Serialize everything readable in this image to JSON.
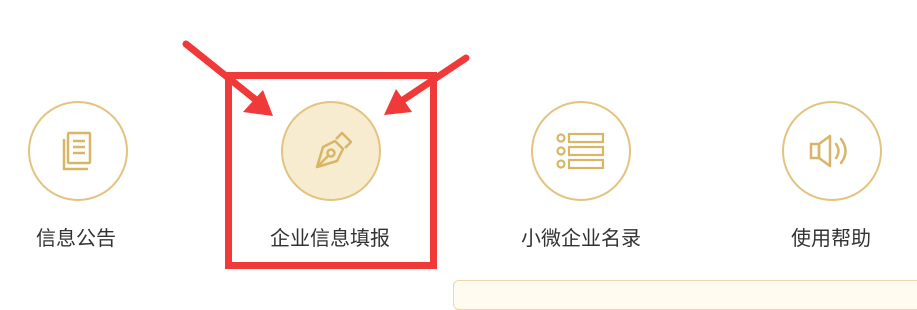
{
  "nav": {
    "items": [
      {
        "label": "信息公告",
        "icon": "document-icon"
      },
      {
        "label": "企业信息填报",
        "icon": "pen-nib-icon",
        "active": true
      },
      {
        "label": "小微企业名录",
        "icon": "list-icon"
      },
      {
        "label": "使用帮助",
        "icon": "speaker-icon"
      }
    ]
  },
  "colors": {
    "icon_stroke": "#d9b567",
    "circle_border": "#e3c37f",
    "active_fill": "#f7eccf",
    "label_text": "#333333",
    "annotation_red": "#f03a3a"
  }
}
